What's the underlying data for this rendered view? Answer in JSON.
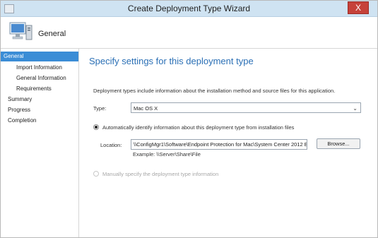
{
  "window": {
    "title": "Create Deployment Type Wizard",
    "close_label": "X"
  },
  "header": {
    "title": "General",
    "icon": "computer-icon"
  },
  "nav": {
    "items": [
      {
        "label": "General",
        "active": true
      },
      {
        "label": "Import Information",
        "active": false
      },
      {
        "label": "General Information",
        "active": false
      },
      {
        "label": "Requirements",
        "active": false
      },
      {
        "label": "Summary",
        "active": false
      },
      {
        "label": "Progress",
        "active": false
      },
      {
        "label": "Completion",
        "active": false
      }
    ]
  },
  "content": {
    "heading": "Specify settings for this deployment type",
    "description": "Deployment types include information about the installation method and source files for this application.",
    "type_label": "Type:",
    "type_value": "Mac OS X",
    "option_auto_label": "Automatically identify information about this deployment type from installation files",
    "location_label": "Location:",
    "location_value": "\\\\ConfigMgr1\\Software\\Endpoint Protection for Mac\\System Center 2012 Enc",
    "example_text": "Example: \\\\Server\\Share\\File",
    "browse_label": "Browse...",
    "option_manual_label": "Manually specify the deployment type information"
  }
}
